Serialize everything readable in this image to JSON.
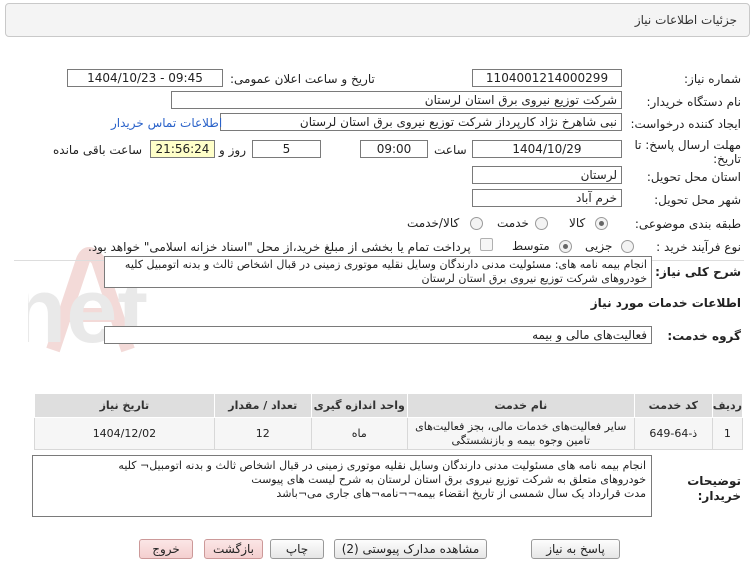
{
  "header": {
    "title": "جزئیات اطلاعات نیاز"
  },
  "form": {
    "need_number_label": "شماره نیاز:",
    "need_number": "1104001214000299",
    "announce_label": "تاریخ و ساعت اعلان عمومی:",
    "announce_value": "1404/10/23 - 09:45",
    "buyer_label": "نام دستگاه خریدار:",
    "buyer_value": "شرکت توزیع نیروی برق استان لرستان",
    "creator_label": "ایجاد کننده درخواست:",
    "creator_value": "نبی شاهرخ نژاد کارپرداز شرکت توزیع نیروی برق استان لرستان",
    "contact_link": "اطلاعات تماس خریدار",
    "deadline_label_1": "مهلت ارسال پاسخ: تا",
    "deadline_label_2": "تاریخ:",
    "deadline_date": "1404/10/29",
    "time_label": "ساعت",
    "deadline_time": "09:00",
    "days_value": "5",
    "days_label": "روز و",
    "remaining_time": "21:56:24",
    "remaining_label": "ساعت باقی مانده",
    "province_label": "استان محل تحویل:",
    "province_value": "لرستان",
    "city_label": "شهر محل تحویل:",
    "city_value": "خرم آباد",
    "category_label": "طبقه بندی موضوعی:",
    "category_options": [
      "کالا",
      "خدمت",
      "کالا/خدمت"
    ],
    "category_selected": "کالا",
    "process_label": "نوع فرآیند خرید :",
    "process_options": [
      "جزیی",
      "متوسط"
    ],
    "process_selected": "متوسط",
    "payment_note": "پرداخت تمام یا بخشی از مبلغ خرید،از محل \"اسناد خزانه اسلامی\" خواهد بود."
  },
  "summary": {
    "label": "شرح کلی نیاز:",
    "text": "انجام بیمه نامه های: مسئولیت مدنی دارندگان وسایل نقلیه موتوری زمینی در قبال اشخاص ثالث و بدنه اتومبیل کلیه خودروهای  شرکت توزیع نیروی برق استان لرستان"
  },
  "services": {
    "section_title": "اطلاعات خدمات مورد نیاز",
    "group_label": "گروه خدمت:",
    "group_value": "فعالیت‌های مالی و بیمه",
    "table": {
      "headers": [
        "ردیف",
        "کد خدمت",
        "نام خدمت",
        "واحد اندازه گیری",
        "تعداد / مقدار",
        "تاریخ نیاز"
      ],
      "rows": [
        {
          "row": "1",
          "code": "ذ-64-649",
          "name": "سایر فعالیت‌های خدمات مالی، بجز فعالیت‌های تامین وجوه بیمه و بازنشستگی",
          "unit": "ماه",
          "qty": "12",
          "date": "1404/12/02"
        }
      ]
    }
  },
  "buyer_notes": {
    "label_1": "توضیحات",
    "label_2": "خریدار:",
    "line_1": "انجام بیمه نامه های مسئولیت مدنی دارندگان وسایل نقلیه موتوری زمینی در قبال اشخاص ثالث و بدنه اتومبیل¬ کلیه",
    "line_2": "خودروهای متعلق به شرکت توزیع نیروی برق استان لرستان به شرح لیست های پیوست",
    "line_3": "مدت قرارداد یک سال شمسی از تاریخ انقضاء بیمه¬¬نامه¬های جاری می¬باشد"
  },
  "buttons": {
    "reply": "پاسخ به نیاز",
    "view_docs": "مشاهده مدارک پیوستی (2)",
    "print": "چاپ",
    "back": "بازگشت",
    "exit": "خروج"
  },
  "watermark": {
    "text": "AriaTender.net"
  }
}
